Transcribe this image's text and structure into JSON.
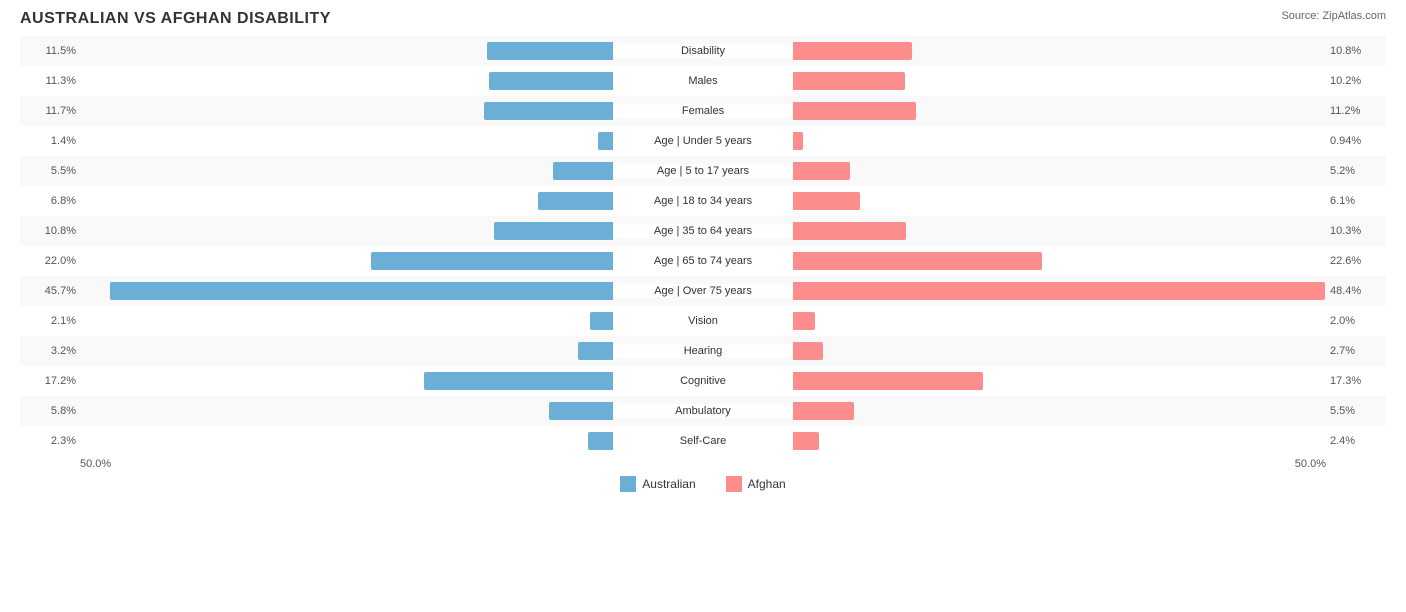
{
  "title": "AUSTRALIAN VS AFGHAN DISABILITY",
  "source": "Source: ZipAtlas.com",
  "colors": {
    "australian": "#6baed6",
    "afghan": "#fc8d8d"
  },
  "max_value": 50,
  "rows": [
    {
      "label": "Disability",
      "left_val": "11.5%",
      "right_val": "10.8%",
      "left_pct": 11.5,
      "right_pct": 10.8
    },
    {
      "label": "Males",
      "left_val": "11.3%",
      "right_val": "10.2%",
      "left_pct": 11.3,
      "right_pct": 10.2
    },
    {
      "label": "Females",
      "left_val": "11.7%",
      "right_val": "11.2%",
      "left_pct": 11.7,
      "right_pct": 11.2
    },
    {
      "label": "Age | Under 5 years",
      "left_val": "1.4%",
      "right_val": "0.94%",
      "left_pct": 1.4,
      "right_pct": 0.94
    },
    {
      "label": "Age | 5 to 17 years",
      "left_val": "5.5%",
      "right_val": "5.2%",
      "left_pct": 5.5,
      "right_pct": 5.2
    },
    {
      "label": "Age | 18 to 34 years",
      "left_val": "6.8%",
      "right_val": "6.1%",
      "left_pct": 6.8,
      "right_pct": 6.1
    },
    {
      "label": "Age | 35 to 64 years",
      "left_val": "10.8%",
      "right_val": "10.3%",
      "left_pct": 10.8,
      "right_pct": 10.3
    },
    {
      "label": "Age | 65 to 74 years",
      "left_val": "22.0%",
      "right_val": "22.6%",
      "left_pct": 22.0,
      "right_pct": 22.6
    },
    {
      "label": "Age | Over 75 years",
      "left_val": "45.7%",
      "right_val": "48.4%",
      "left_pct": 45.7,
      "right_pct": 48.4
    },
    {
      "label": "Vision",
      "left_val": "2.1%",
      "right_val": "2.0%",
      "left_pct": 2.1,
      "right_pct": 2.0
    },
    {
      "label": "Hearing",
      "left_val": "3.2%",
      "right_val": "2.7%",
      "left_pct": 3.2,
      "right_pct": 2.7
    },
    {
      "label": "Cognitive",
      "left_val": "17.2%",
      "right_val": "17.3%",
      "left_pct": 17.2,
      "right_pct": 17.3
    },
    {
      "label": "Ambulatory",
      "left_val": "5.8%",
      "right_val": "5.5%",
      "left_pct": 5.8,
      "right_pct": 5.5
    },
    {
      "label": "Self-Care",
      "left_val": "2.3%",
      "right_val": "2.4%",
      "left_pct": 2.3,
      "right_pct": 2.4
    }
  ],
  "axis": {
    "left": "50.0%",
    "right": "50.0%"
  },
  "legend": {
    "left_label": "Australian",
    "right_label": "Afghan"
  }
}
